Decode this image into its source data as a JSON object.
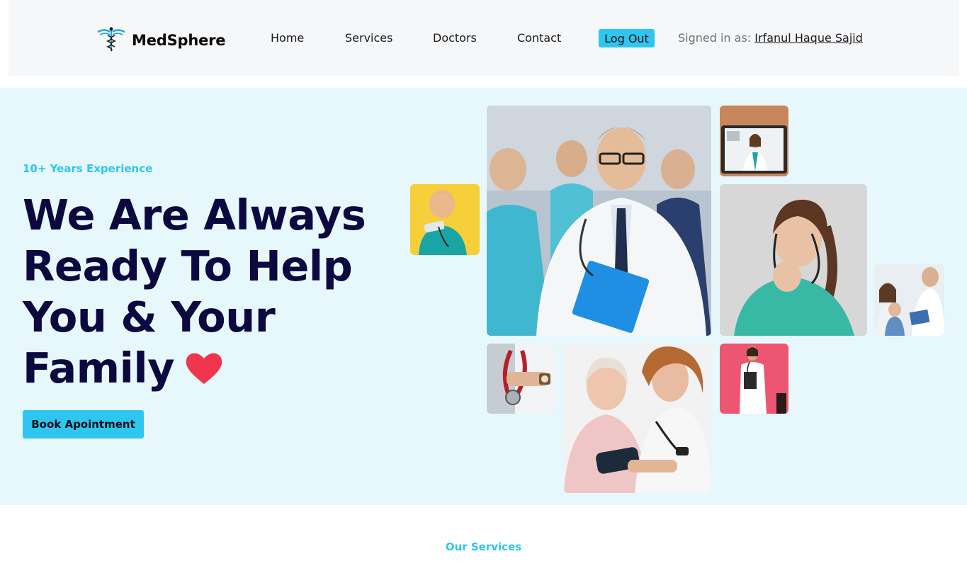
{
  "header": {
    "logo_text": "MedSphere",
    "logo_icon": "caduceus-icon",
    "nav": [
      {
        "label": "Home"
      },
      {
        "label": "Services"
      },
      {
        "label": "Doctors"
      },
      {
        "label": "Contact"
      }
    ],
    "logout_label": "Log Out",
    "signed_in_prefix": "Signed in as:",
    "signed_in_user": "Irfanul Haque Sajid"
  },
  "hero": {
    "tagline": "10+ Years Experience",
    "headline_lines": [
      "We Are Always",
      "Ready To Help",
      "You & Your",
      "Family"
    ],
    "heart_icon": "heart-icon",
    "cta_label": "Book Apointment"
  },
  "services": {
    "label": "Our Services"
  },
  "colors": {
    "accent": "#2ec6ee",
    "headline": "#0c0840",
    "hero_bg": "#e7f8fd",
    "heart": "#f0364f"
  }
}
